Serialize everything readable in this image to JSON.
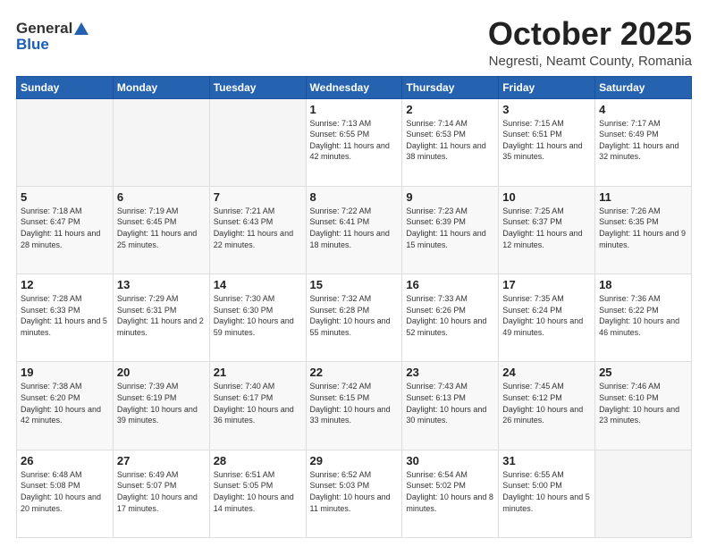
{
  "header": {
    "logo_general": "General",
    "logo_blue": "Blue",
    "month_title": "October 2025",
    "location": "Negresti, Neamt County, Romania"
  },
  "days_of_week": [
    "Sunday",
    "Monday",
    "Tuesday",
    "Wednesday",
    "Thursday",
    "Friday",
    "Saturday"
  ],
  "weeks": [
    [
      {
        "day": "",
        "info": ""
      },
      {
        "day": "",
        "info": ""
      },
      {
        "day": "",
        "info": ""
      },
      {
        "day": "1",
        "info": "Sunrise: 7:13 AM\nSunset: 6:55 PM\nDaylight: 11 hours and 42 minutes."
      },
      {
        "day": "2",
        "info": "Sunrise: 7:14 AM\nSunset: 6:53 PM\nDaylight: 11 hours and 38 minutes."
      },
      {
        "day": "3",
        "info": "Sunrise: 7:15 AM\nSunset: 6:51 PM\nDaylight: 11 hours and 35 minutes."
      },
      {
        "day": "4",
        "info": "Sunrise: 7:17 AM\nSunset: 6:49 PM\nDaylight: 11 hours and 32 minutes."
      }
    ],
    [
      {
        "day": "5",
        "info": "Sunrise: 7:18 AM\nSunset: 6:47 PM\nDaylight: 11 hours and 28 minutes."
      },
      {
        "day": "6",
        "info": "Sunrise: 7:19 AM\nSunset: 6:45 PM\nDaylight: 11 hours and 25 minutes."
      },
      {
        "day": "7",
        "info": "Sunrise: 7:21 AM\nSunset: 6:43 PM\nDaylight: 11 hours and 22 minutes."
      },
      {
        "day": "8",
        "info": "Sunrise: 7:22 AM\nSunset: 6:41 PM\nDaylight: 11 hours and 18 minutes."
      },
      {
        "day": "9",
        "info": "Sunrise: 7:23 AM\nSunset: 6:39 PM\nDaylight: 11 hours and 15 minutes."
      },
      {
        "day": "10",
        "info": "Sunrise: 7:25 AM\nSunset: 6:37 PM\nDaylight: 11 hours and 12 minutes."
      },
      {
        "day": "11",
        "info": "Sunrise: 7:26 AM\nSunset: 6:35 PM\nDaylight: 11 hours and 9 minutes."
      }
    ],
    [
      {
        "day": "12",
        "info": "Sunrise: 7:28 AM\nSunset: 6:33 PM\nDaylight: 11 hours and 5 minutes."
      },
      {
        "day": "13",
        "info": "Sunrise: 7:29 AM\nSunset: 6:31 PM\nDaylight: 11 hours and 2 minutes."
      },
      {
        "day": "14",
        "info": "Sunrise: 7:30 AM\nSunset: 6:30 PM\nDaylight: 10 hours and 59 minutes."
      },
      {
        "day": "15",
        "info": "Sunrise: 7:32 AM\nSunset: 6:28 PM\nDaylight: 10 hours and 55 minutes."
      },
      {
        "day": "16",
        "info": "Sunrise: 7:33 AM\nSunset: 6:26 PM\nDaylight: 10 hours and 52 minutes."
      },
      {
        "day": "17",
        "info": "Sunrise: 7:35 AM\nSunset: 6:24 PM\nDaylight: 10 hours and 49 minutes."
      },
      {
        "day": "18",
        "info": "Sunrise: 7:36 AM\nSunset: 6:22 PM\nDaylight: 10 hours and 46 minutes."
      }
    ],
    [
      {
        "day": "19",
        "info": "Sunrise: 7:38 AM\nSunset: 6:20 PM\nDaylight: 10 hours and 42 minutes."
      },
      {
        "day": "20",
        "info": "Sunrise: 7:39 AM\nSunset: 6:19 PM\nDaylight: 10 hours and 39 minutes."
      },
      {
        "day": "21",
        "info": "Sunrise: 7:40 AM\nSunset: 6:17 PM\nDaylight: 10 hours and 36 minutes."
      },
      {
        "day": "22",
        "info": "Sunrise: 7:42 AM\nSunset: 6:15 PM\nDaylight: 10 hours and 33 minutes."
      },
      {
        "day": "23",
        "info": "Sunrise: 7:43 AM\nSunset: 6:13 PM\nDaylight: 10 hours and 30 minutes."
      },
      {
        "day": "24",
        "info": "Sunrise: 7:45 AM\nSunset: 6:12 PM\nDaylight: 10 hours and 26 minutes."
      },
      {
        "day": "25",
        "info": "Sunrise: 7:46 AM\nSunset: 6:10 PM\nDaylight: 10 hours and 23 minutes."
      }
    ],
    [
      {
        "day": "26",
        "info": "Sunrise: 6:48 AM\nSunset: 5:08 PM\nDaylight: 10 hours and 20 minutes."
      },
      {
        "day": "27",
        "info": "Sunrise: 6:49 AM\nSunset: 5:07 PM\nDaylight: 10 hours and 17 minutes."
      },
      {
        "day": "28",
        "info": "Sunrise: 6:51 AM\nSunset: 5:05 PM\nDaylight: 10 hours and 14 minutes."
      },
      {
        "day": "29",
        "info": "Sunrise: 6:52 AM\nSunset: 5:03 PM\nDaylight: 10 hours and 11 minutes."
      },
      {
        "day": "30",
        "info": "Sunrise: 6:54 AM\nSunset: 5:02 PM\nDaylight: 10 hours and 8 minutes."
      },
      {
        "day": "31",
        "info": "Sunrise: 6:55 AM\nSunset: 5:00 PM\nDaylight: 10 hours and 5 minutes."
      },
      {
        "day": "",
        "info": ""
      }
    ]
  ]
}
